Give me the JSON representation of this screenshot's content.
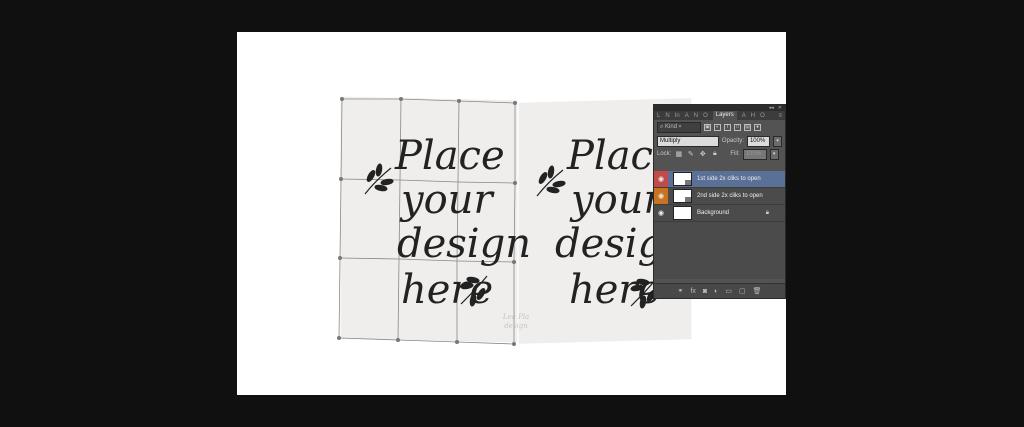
{
  "mockup": {
    "left_text": [
      "Place",
      "your",
      "design",
      "here"
    ],
    "right_text": [
      "Place",
      "your",
      "design",
      "here"
    ],
    "watermark": [
      "Lea Pla",
      "design"
    ]
  },
  "layers_panel": {
    "tabs": [
      "L",
      "N",
      "In",
      "A",
      "N",
      "O",
      "Layers",
      "A",
      "H",
      "O"
    ],
    "active_tab": "Layers",
    "kind_label": "Kind",
    "blend_mode": "Multiply",
    "opacity_label": "Opacity:",
    "opacity_value": "100%",
    "lock_label": "Lock:",
    "fill_label": "Fill:",
    "fill_value": "100%",
    "layers": [
      {
        "name": "1st side 2x cliks to open",
        "selected": true,
        "eye_color": "#c24a4a"
      },
      {
        "name": "2nd side 2x cliks to open",
        "selected": false,
        "eye_color": "#c8731f"
      },
      {
        "name": "Background",
        "selected": false,
        "locked": true
      }
    ],
    "bottom_icons": [
      "link-icon",
      "fx-icon",
      "mask-icon",
      "adjustment-icon",
      "folder-icon",
      "new-layer-icon",
      "trash-icon"
    ]
  }
}
